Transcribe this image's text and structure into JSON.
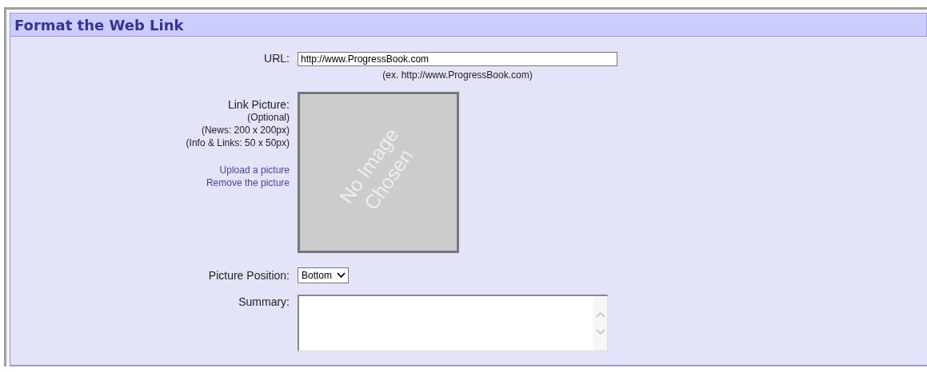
{
  "panel": {
    "title": "Format the Web Link"
  },
  "url": {
    "label": "URL:",
    "value": "http://www.ProgressBook.com",
    "hint": "(ex. http://www.ProgressBook.com)"
  },
  "link_picture": {
    "label": "Link Picture:",
    "notes": [
      "(Optional)",
      "(News: 200 x 200px)",
      "(Info & Links: 50 x 50px)"
    ],
    "links": [
      "Upload a picture",
      "Remove the picture"
    ],
    "image_text": [
      "No Image",
      "Chosen"
    ]
  },
  "picture_position": {
    "label": "Picture Position:",
    "value": "Bottom"
  },
  "summary": {
    "label": "Summary:"
  }
}
